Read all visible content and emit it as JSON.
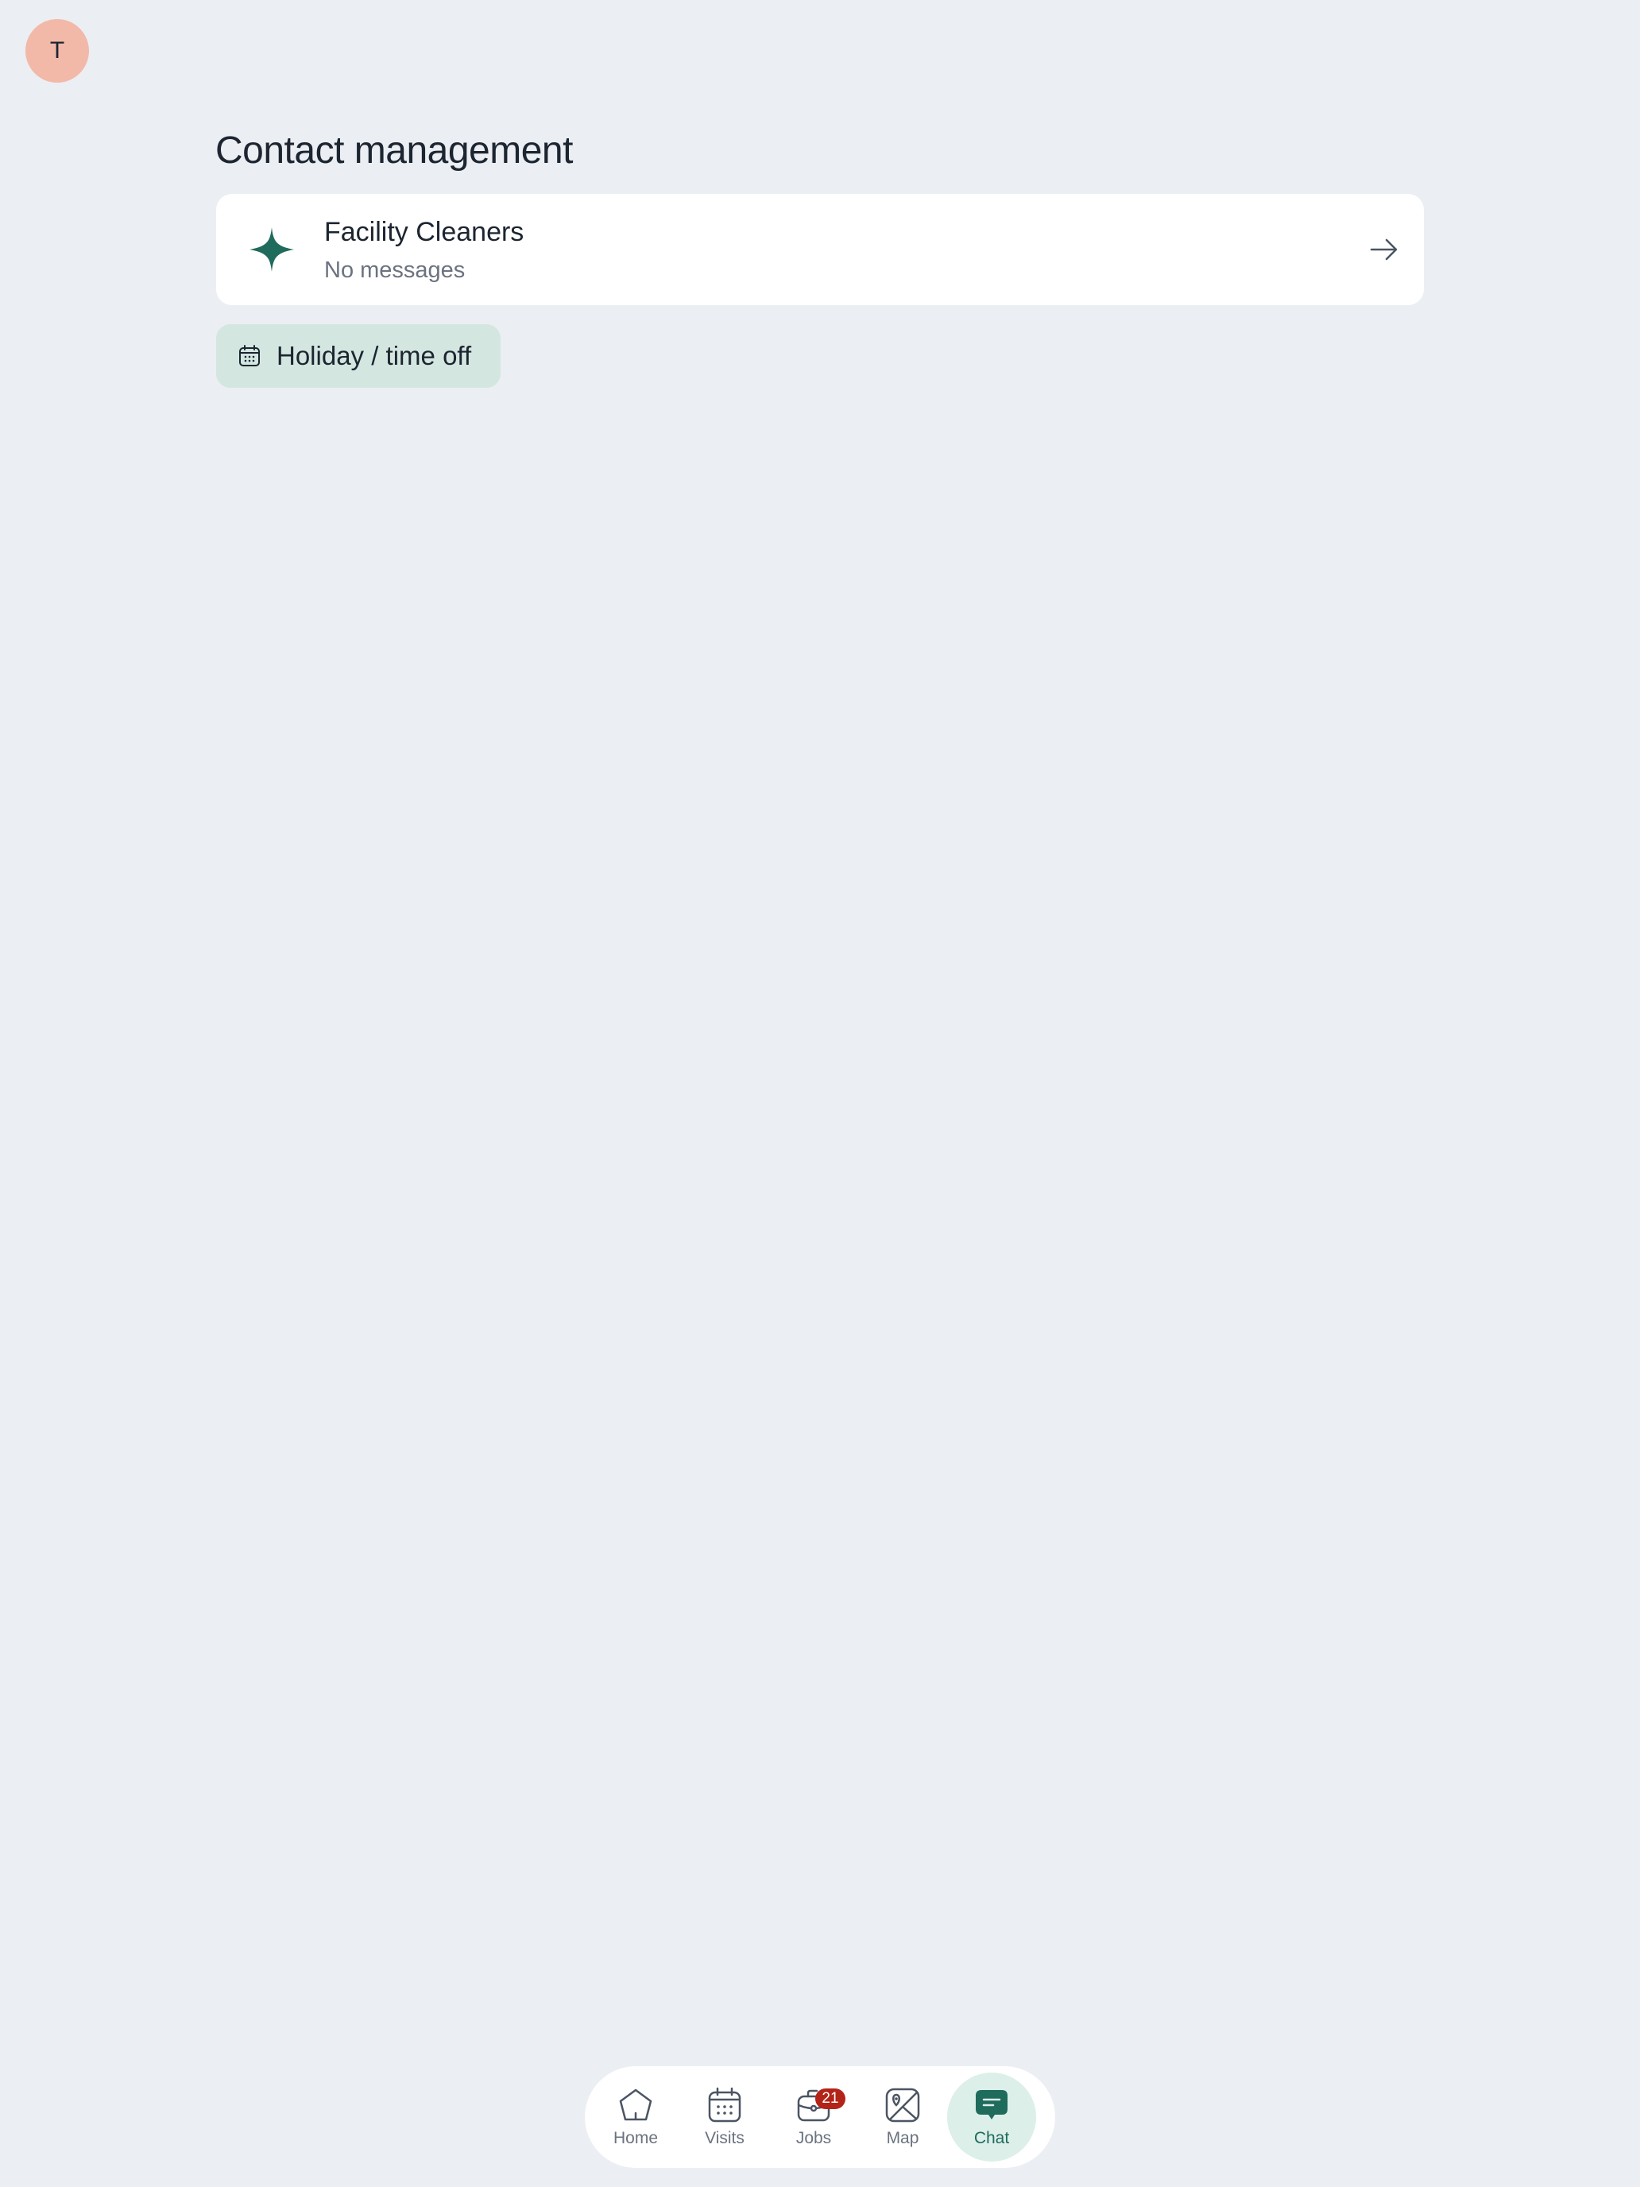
{
  "header": {
    "avatar_initial": "T",
    "title": "Contact management"
  },
  "contacts": [
    {
      "name": "Facility Cleaners",
      "subtitle": "No messages",
      "icon": "sparkle-icon",
      "action_icon": "arrow-right-icon"
    }
  ],
  "holiday_button": {
    "label": "Holiday / time off",
    "icon": "calendar-icon"
  },
  "nav": {
    "items": [
      {
        "label": "Home",
        "icon": "home-icon",
        "active": false
      },
      {
        "label": "Visits",
        "icon": "calendar-icon",
        "active": false
      },
      {
        "label": "Jobs",
        "icon": "briefcase-icon",
        "active": false,
        "badge": "21"
      },
      {
        "label": "Map",
        "icon": "map-icon",
        "active": false
      },
      {
        "label": "Chat",
        "icon": "chat-icon",
        "active": true
      }
    ]
  },
  "colors": {
    "background": "#ebeef3",
    "accent": "#1f6b5c",
    "avatar_bg": "#f2b9a8",
    "holiday_bg": "#d3e6e0",
    "badge_bg": "#b42318",
    "active_nav_bg": "#dcefe9"
  }
}
